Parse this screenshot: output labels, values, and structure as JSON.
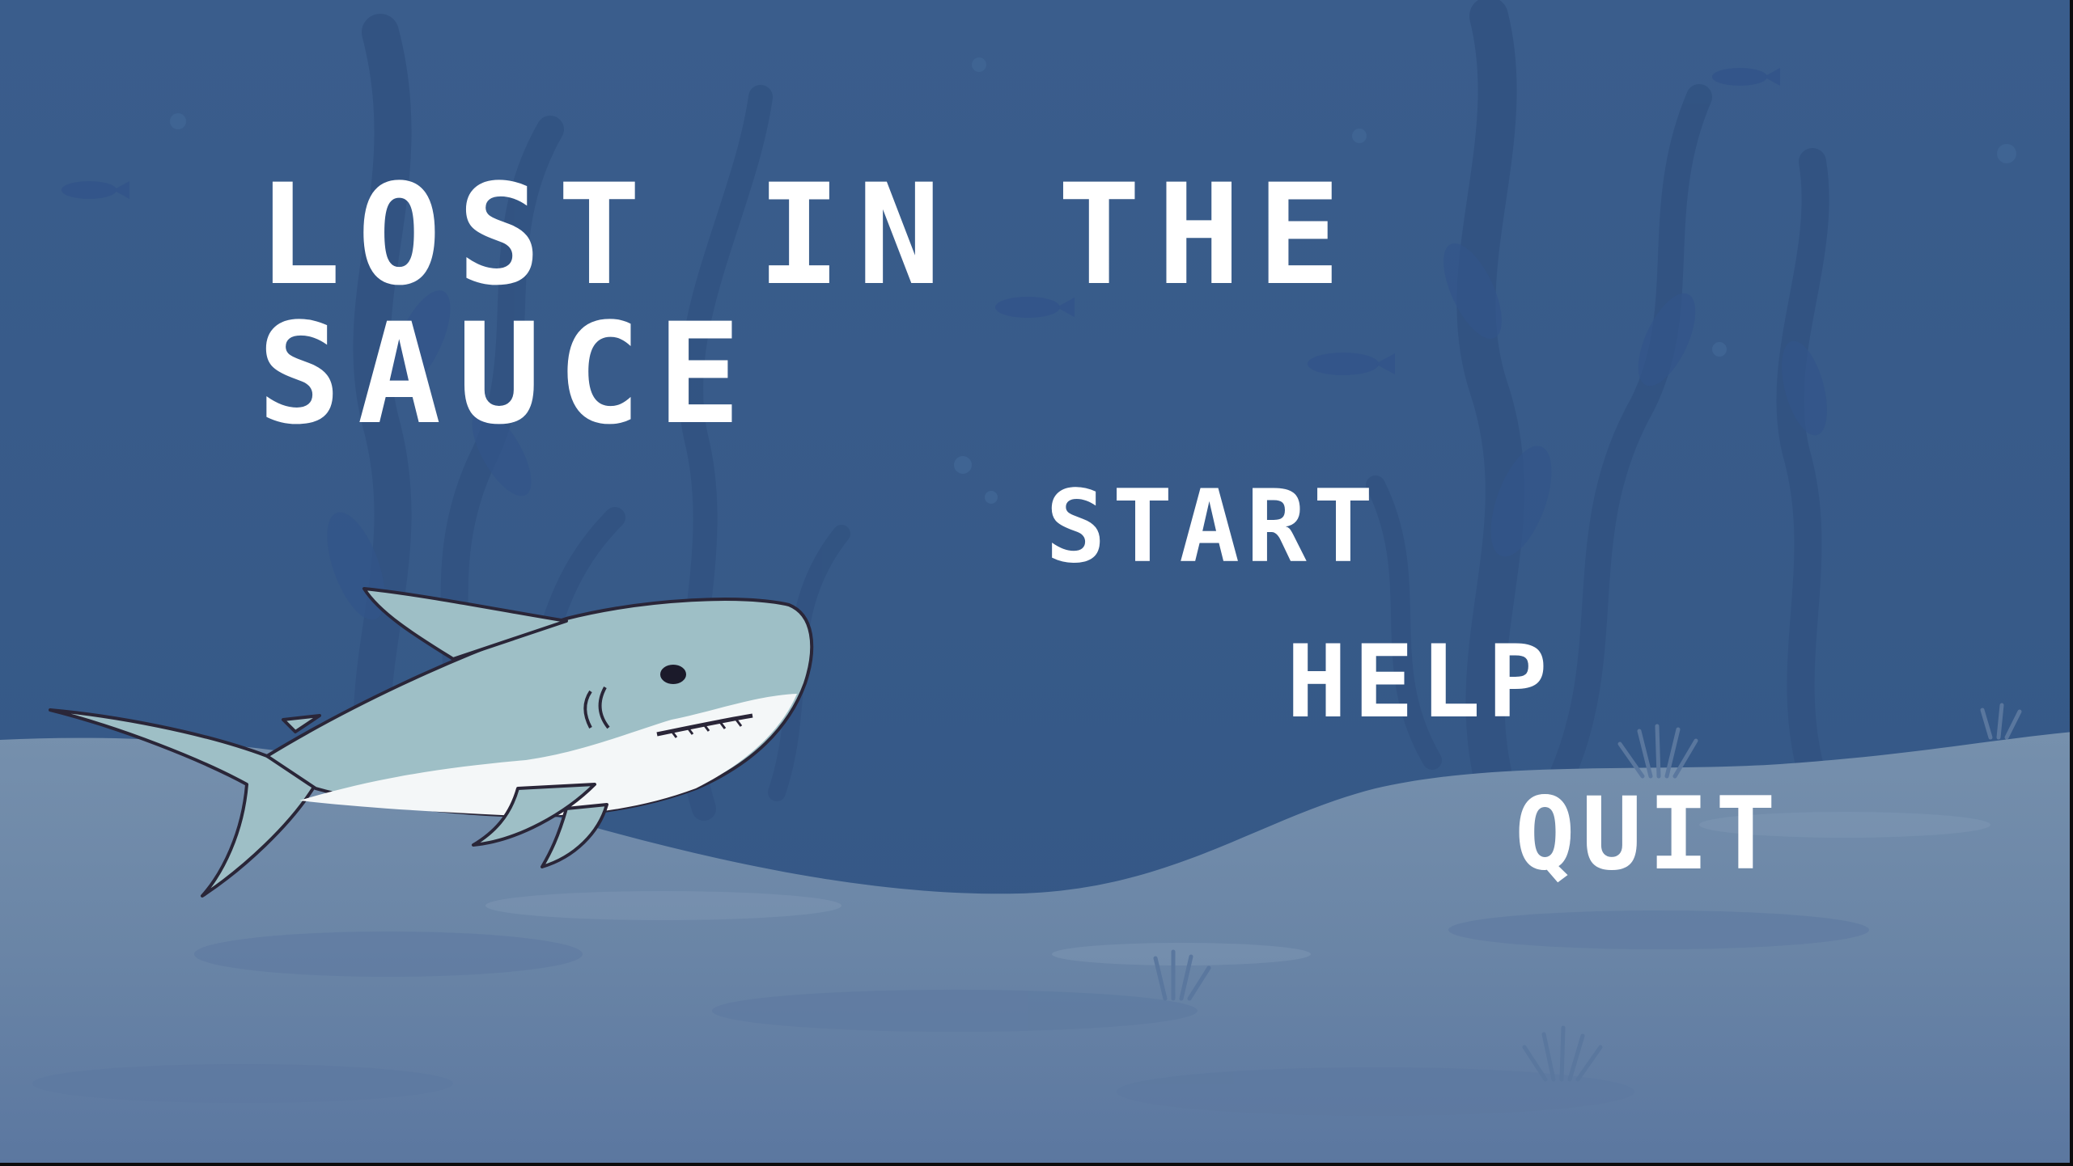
{
  "game": {
    "title_line1": "LOST IN THE",
    "title_line2": "SAUCE"
  },
  "menu": {
    "start_label": "START",
    "help_label": "HELP",
    "quit_label": "QUIT"
  },
  "colors": {
    "water": "#3a5d8c",
    "sand": "#6f89a8",
    "kelp_shadow": "#2f4f7a",
    "shark_body": "#9ebfc6",
    "shark_belly": "#f4f7f8",
    "shark_outline": "#2a2638",
    "text": "#ffffff"
  },
  "icons": [
    "shark-character",
    "kelp-silhouette",
    "fish-silhouette",
    "sea-plant"
  ]
}
